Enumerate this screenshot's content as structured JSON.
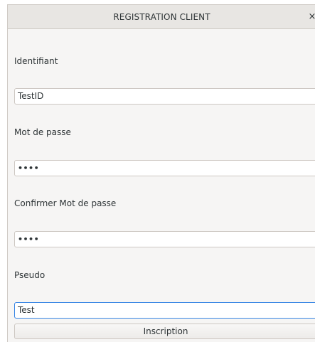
{
  "window": {
    "title": "REGISTRATION CLIENT",
    "close_glyph": "×"
  },
  "form": {
    "identifiant": {
      "label": "Identifiant",
      "value": "TestID"
    },
    "password": {
      "label": "Mot de passe",
      "value": "••••"
    },
    "confirm_password": {
      "label": "Confirmer Mot de passe",
      "value": "••••"
    },
    "pseudo": {
      "label": "Pseudo",
      "value": "Test"
    },
    "submit_label": "Inscription"
  }
}
